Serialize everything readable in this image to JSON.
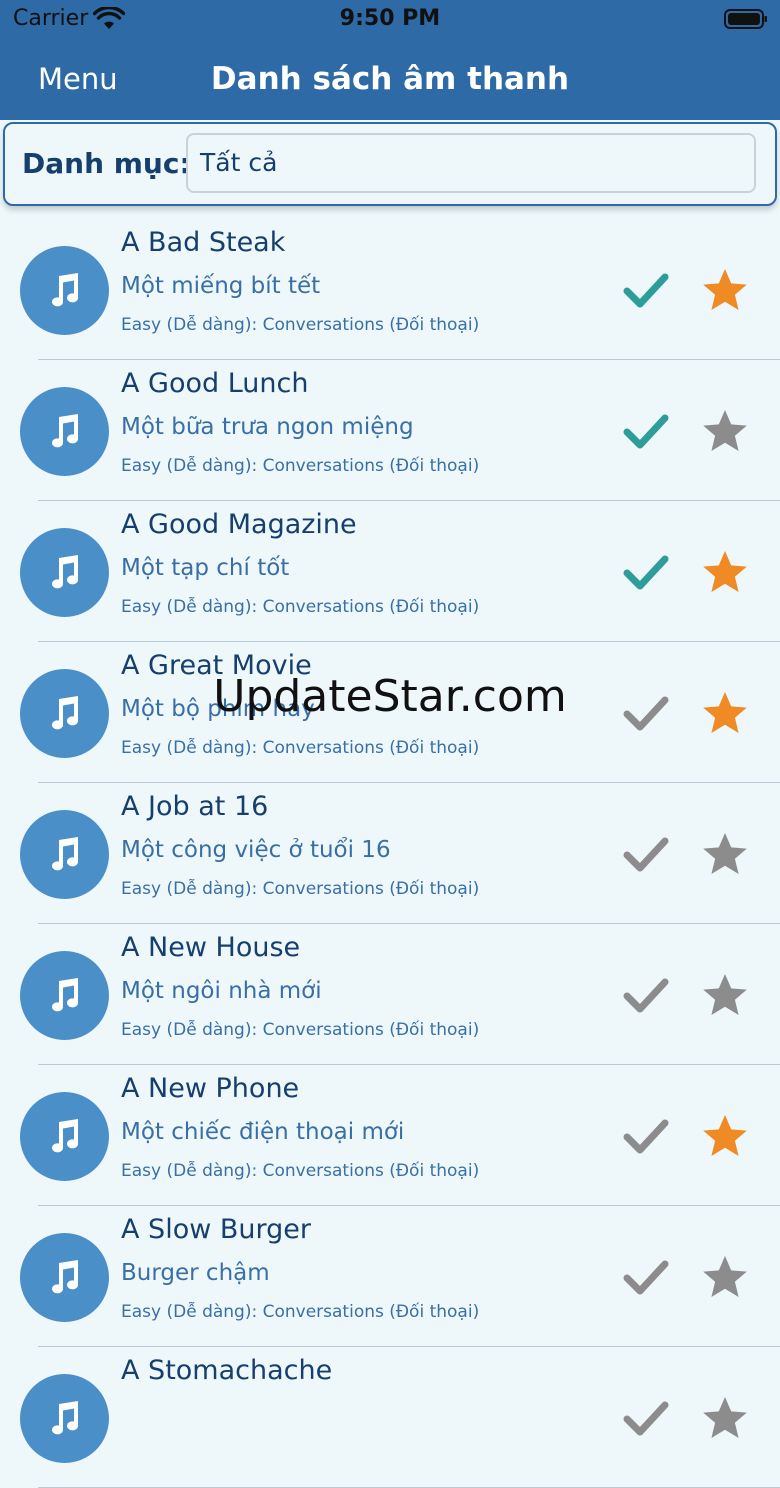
{
  "status_bar": {
    "carrier": "Carrier",
    "time": "9:50 PM"
  },
  "nav_bar": {
    "menu_label": "Menu",
    "title": "Danh sách âm thanh"
  },
  "category_filter": {
    "label": "Danh mục:",
    "value": "Tất cả"
  },
  "colors": {
    "bar": "#2e6aa6",
    "background": "#eef8fb",
    "check_on": "#2e9c99",
    "check_off": "#8c8c8c",
    "star_on": "#f08a24",
    "star_off": "#8c8c8c",
    "avatar": "#4b8fc9"
  },
  "items": [
    {
      "title": "A Bad Steak",
      "subtitle": "Một miếng bít tết",
      "category": "Easy (Dễ dàng): Conversations (Đối thoại)",
      "completed": true,
      "favorite": true
    },
    {
      "title": "A Good Lunch",
      "subtitle": "Một bữa trưa ngon miệng",
      "category": "Easy (Dễ dàng): Conversations (Đối thoại)",
      "completed": true,
      "favorite": false
    },
    {
      "title": "A Good Magazine",
      "subtitle": "Một tạp chí tốt",
      "category": "Easy (Dễ dàng): Conversations (Đối thoại)",
      "completed": true,
      "favorite": true
    },
    {
      "title": "A Great Movie",
      "subtitle": "Một bộ phim hay",
      "category": "Easy (Dễ dàng): Conversations (Đối thoại)",
      "completed": false,
      "favorite": true
    },
    {
      "title": "A Job at 16",
      "subtitle": "Một công việc ở tuổi 16",
      "category": "Easy (Dễ dàng): Conversations (Đối thoại)",
      "completed": false,
      "favorite": false
    },
    {
      "title": "A New House",
      "subtitle": "Một ngôi nhà mới",
      "category": "Easy (Dễ dàng): Conversations (Đối thoại)",
      "completed": false,
      "favorite": false
    },
    {
      "title": "A New Phone",
      "subtitle": "Một chiếc điện thoại mới",
      "category": "Easy (Dễ dàng): Conversations (Đối thoại)",
      "completed": false,
      "favorite": true
    },
    {
      "title": "A Slow Burger",
      "subtitle": "Burger chậm",
      "category": "Easy (Dễ dàng): Conversations (Đối thoại)",
      "completed": false,
      "favorite": false
    },
    {
      "title": "A Stomachache",
      "subtitle": "",
      "category": "",
      "completed": false,
      "favorite": false
    }
  ],
  "watermark": "UpdateStar.com"
}
